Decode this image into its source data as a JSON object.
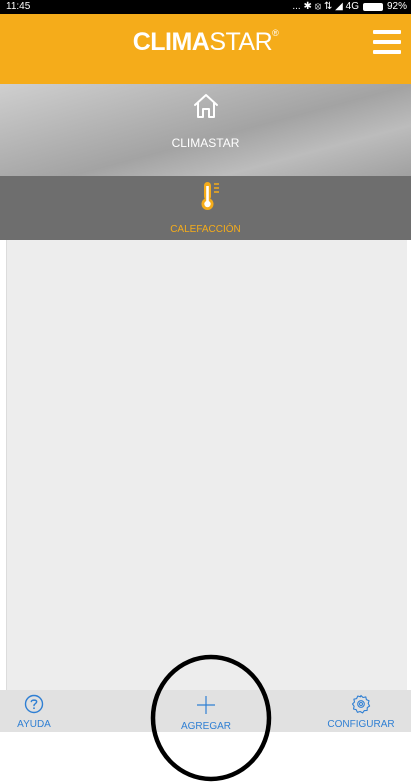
{
  "status_bar": {
    "time": "11:45",
    "indicators": "... ✱ ⦻ ⇅ ◢ 4G",
    "battery_percent": "92%"
  },
  "header": {
    "brand_bold": "CLIMA",
    "brand_light": "STAR",
    "brand_reg": "®",
    "menu_icon": "hamburger-menu-icon",
    "background_color": "#f5ac1a"
  },
  "home": {
    "icon": "home-icon",
    "label": "CLIMASTAR"
  },
  "category": {
    "icon": "thermometer-icon",
    "label": "CALEFACCIÓN",
    "accent_color": "#f5ac1a"
  },
  "bottom_nav": {
    "help": {
      "icon": "help-circle-icon",
      "label": "AYUDA"
    },
    "add": {
      "icon": "plus-icon",
      "label": "AGREGAR"
    },
    "config": {
      "icon": "gear-icon",
      "label": "CONFIGURAR"
    },
    "link_color": "#2f7fd3"
  }
}
